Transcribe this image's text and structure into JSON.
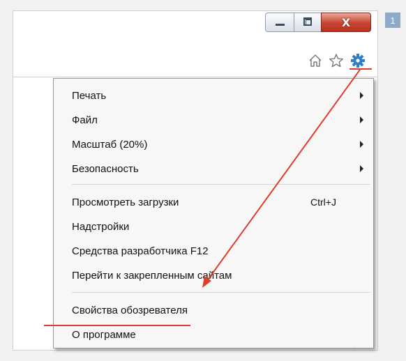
{
  "step_badge": "1",
  "window_controls": {
    "minimize_icon": "minimize-icon",
    "maximize_icon": "restore-icon",
    "close_symbol": "X"
  },
  "toolbar": {
    "home_icon": "home-icon",
    "favorites_icon": "star-icon",
    "settings_icon": "gear-icon",
    "settings_icon_color": "#2f7fc8"
  },
  "menu": {
    "items": [
      {
        "label": "Печать",
        "submenu": true
      },
      {
        "label": "Файл",
        "submenu": true
      },
      {
        "label": "Масштаб (20%)",
        "submenu": true
      },
      {
        "label": "Безопасность",
        "submenu": true
      },
      {
        "label": "Просмотреть загрузки",
        "shortcut": "Ctrl+J"
      },
      {
        "label": "Надстройки"
      },
      {
        "label": "Средства разработчика F12"
      },
      {
        "label": "Перейти к закрепленным сайтам"
      },
      {
        "label": "Свойства обозревателя",
        "highlighted": true
      },
      {
        "label": "О программе"
      }
    ]
  },
  "annotation_color": "#e03c2c"
}
